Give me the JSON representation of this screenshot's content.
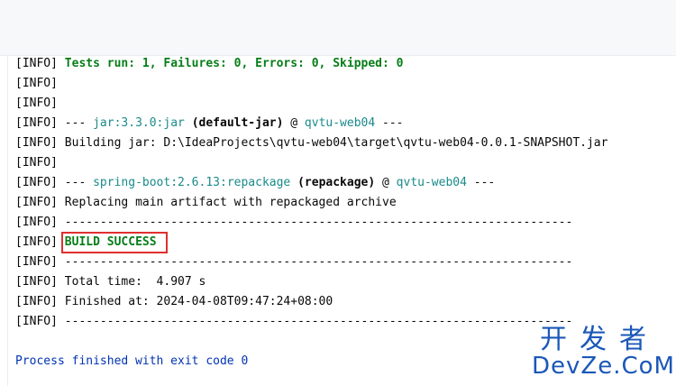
{
  "lines": [
    {
      "level": "[INFO]",
      "parts": [
        {
          "text": "Tests run: 1, Failures: 0, Errors: 0, Skipped: 0",
          "style": "green-bold"
        }
      ]
    },
    {
      "level": "[INFO]",
      "parts": []
    },
    {
      "level": "[INFO]",
      "parts": []
    },
    {
      "level": "[INFO]",
      "parts": [
        {
          "text": "--- ",
          "style": ""
        },
        {
          "text": "jar:3.3.0:jar",
          "style": "teal"
        },
        {
          "text": " ",
          "style": ""
        },
        {
          "text": "(default-jar)",
          "style": "bold"
        },
        {
          "text": " @ ",
          "style": ""
        },
        {
          "text": "qvtu-web04",
          "style": "teal"
        },
        {
          "text": " ---",
          "style": ""
        }
      ]
    },
    {
      "level": "[INFO]",
      "parts": [
        {
          "text": "Building jar: D:\\IdeaProjects\\qvtu-web04\\target\\qvtu-web04-0.0.1-SNAPSHOT.jar",
          "style": ""
        }
      ]
    },
    {
      "level": "[INFO]",
      "parts": []
    },
    {
      "level": "[INFO]",
      "parts": [
        {
          "text": "--- ",
          "style": ""
        },
        {
          "text": "spring-boot:2.6.13:repackage",
          "style": "teal"
        },
        {
          "text": " ",
          "style": ""
        },
        {
          "text": "(repackage)",
          "style": "bold"
        },
        {
          "text": " @ ",
          "style": ""
        },
        {
          "text": "qvtu-web04",
          "style": "teal"
        },
        {
          "text": " ---",
          "style": ""
        }
      ]
    },
    {
      "level": "[INFO]",
      "parts": [
        {
          "text": "Replacing main artifact with repackaged archive",
          "style": ""
        }
      ]
    },
    {
      "level": "[INFO]",
      "parts": [
        {
          "text": "------------------------------------------------------------------------",
          "style": ""
        }
      ]
    },
    {
      "level": "[INFO]",
      "parts": [
        {
          "text": "BUILD SUCCESS",
          "style": "green-bold"
        }
      ]
    },
    {
      "level": "[INFO]",
      "parts": [
        {
          "text": "------------------------------------------------------------------------",
          "style": ""
        }
      ]
    },
    {
      "level": "[INFO]",
      "parts": [
        {
          "text": "Total time:  4.907 s",
          "style": ""
        }
      ]
    },
    {
      "level": "[INFO]",
      "parts": [
        {
          "text": "Finished at: 2024-04-08T09:47:24+08:00",
          "style": ""
        }
      ]
    },
    {
      "level": "[INFO]",
      "parts": [
        {
          "text": "------------------------------------------------------------------------",
          "style": ""
        }
      ]
    }
  ],
  "exit_message": "Process finished with exit code 0",
  "watermark": {
    "cn": "开发者",
    "en": "DevZe.CoM"
  },
  "colors": {
    "success": "#067d17",
    "link": "#1a8a8a",
    "exit": "#0033b3",
    "highlight": "#e02f2f"
  }
}
